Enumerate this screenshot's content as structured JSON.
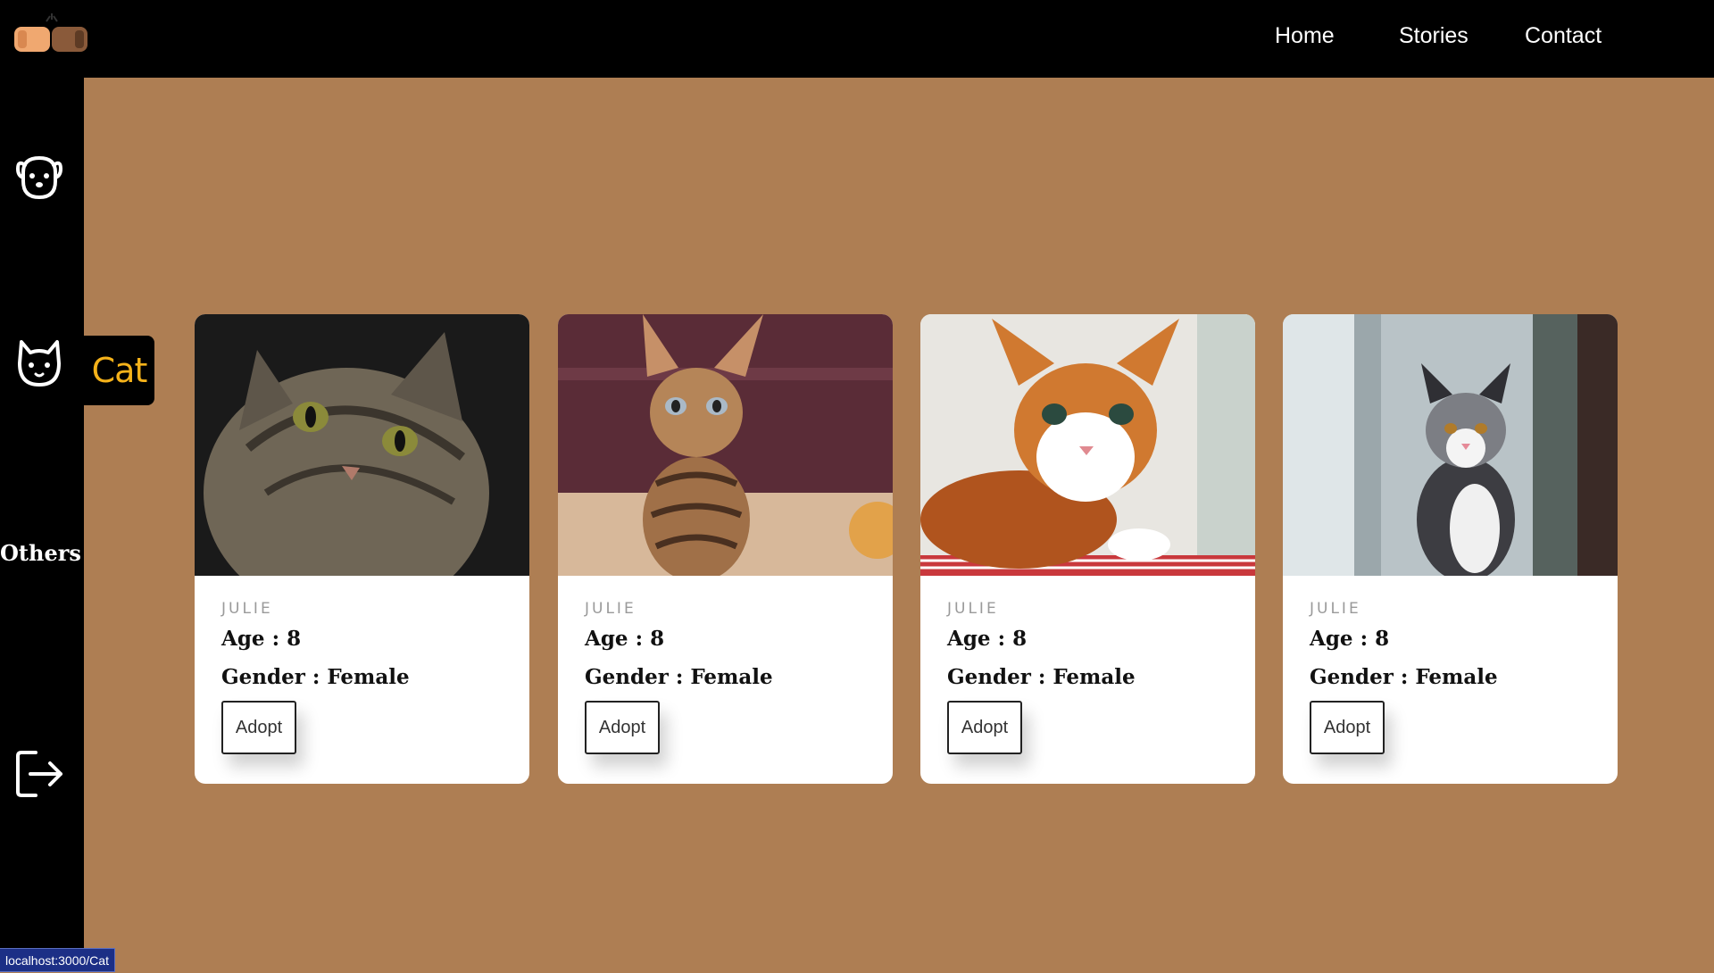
{
  "nav": {
    "links": [
      "Home",
      "Stories",
      "Contact"
    ]
  },
  "sidebar": {
    "items": [
      {
        "icon": "dog-icon"
      },
      {
        "icon": "cat-icon",
        "tooltip": "Cat"
      },
      {
        "label": "Others"
      },
      {
        "icon": "logout-icon"
      }
    ]
  },
  "cards": [
    {
      "name": "JULIE",
      "age": "Age : 8",
      "gender": "Gender : Female",
      "button": "Adopt",
      "image": "tabby kitten"
    },
    {
      "name": "JULIE",
      "age": "Age : 8",
      "gender": "Gender : Female",
      "button": "Adopt",
      "image": "striped kitten"
    },
    {
      "name": "JULIE",
      "age": "Age : 8",
      "gender": "Gender : Female",
      "button": "Adopt",
      "image": "orange and white kitten"
    },
    {
      "name": "JULIE",
      "age": "Age : 8",
      "gender": "Gender : Female",
      "button": "Adopt",
      "image": "grey and white cat"
    }
  ],
  "status_bar": {
    "url": "localhost:3000/Cat"
  },
  "colors": {
    "background": "#ae7e53",
    "bars": "#000000",
    "accent": "#f5b21a",
    "status": "#1c2f86"
  }
}
